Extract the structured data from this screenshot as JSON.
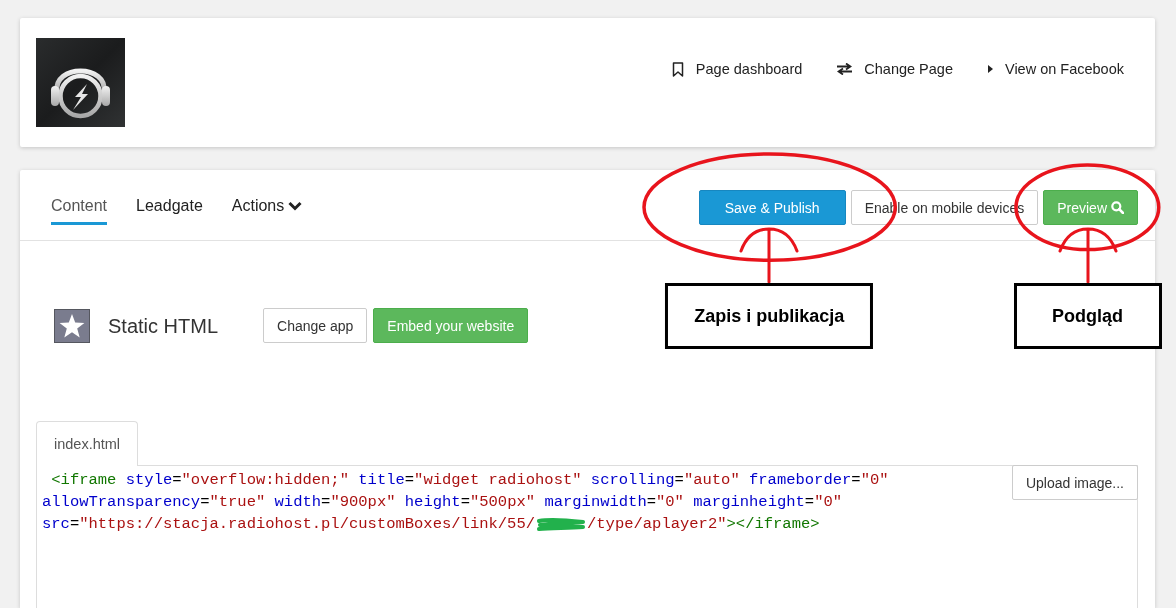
{
  "header": {
    "links": [
      {
        "label": "Page dashboard"
      },
      {
        "label": "Change Page"
      },
      {
        "label": "View on Facebook"
      }
    ]
  },
  "tabs": [
    {
      "label": "Content",
      "selected": true,
      "dropdown": false
    },
    {
      "label": "Leadgate",
      "selected": false,
      "dropdown": false
    },
    {
      "label": "Actions",
      "selected": false,
      "dropdown": true
    }
  ],
  "toolbar": [
    {
      "label": "Save & Publish",
      "kind": "primary",
      "icon": false,
      "annotation": "Zapis i publikacja"
    },
    {
      "label": "Enable on mobile devices",
      "kind": "default",
      "icon": false
    },
    {
      "label": "Preview",
      "kind": "success",
      "icon": true,
      "annotation": "Podgląd"
    }
  ],
  "app": {
    "name": "Static HTML",
    "buttons": [
      {
        "label": "Change app",
        "kind": "default"
      },
      {
        "label": "Embed your website",
        "kind": "success"
      }
    ]
  },
  "editor": {
    "file_tabs": [
      {
        "label": "index.html",
        "selected": true
      }
    ],
    "upload_button": "Upload image...",
    "lines": [
      [
        {
          "kind": "code",
          "tokens": [
            {
              "kind": "tag",
              "text": " <iframe"
            },
            {
              "kind": "attr",
              "text": " style"
            },
            {
              "kind": "plain",
              "text": "="
            },
            {
              "kind": "string",
              "text": "\"overflow:hidden;\""
            },
            {
              "kind": "attr",
              "text": " title"
            },
            {
              "kind": "plain",
              "text": "="
            },
            {
              "kind": "string",
              "text": "\"widget radiohost\""
            },
            {
              "kind": "attr",
              "text": " scrolling"
            },
            {
              "kind": "plain",
              "text": "="
            },
            {
              "kind": "string",
              "text": "\"auto\""
            },
            {
              "kind": "attr",
              "text": " frameborder"
            },
            {
              "kind": "plain",
              "text": "="
            },
            {
              "kind": "string",
              "text": "\"0\""
            }
          ]
        }
      ],
      [
        {
          "kind": "code",
          "tokens": [
            {
              "kind": "attr",
              "text": "allowTransparency"
            },
            {
              "kind": "plain",
              "text": "="
            },
            {
              "kind": "string",
              "text": "\"true\""
            },
            {
              "kind": "attr",
              "text": " width"
            },
            {
              "kind": "plain",
              "text": "="
            },
            {
              "kind": "string",
              "text": "\"900px\""
            },
            {
              "kind": "attr",
              "text": " height"
            },
            {
              "kind": "plain",
              "text": "="
            },
            {
              "kind": "string",
              "text": "\"500px\""
            },
            {
              "kind": "attr",
              "text": " marginwidth"
            },
            {
              "kind": "plain",
              "text": "="
            },
            {
              "kind": "string",
              "text": "\"0\""
            },
            {
              "kind": "attr",
              "text": " marginheight"
            },
            {
              "kind": "plain",
              "text": "="
            },
            {
              "kind": "string",
              "text": "\"0\""
            }
          ]
        }
      ],
      [
        {
          "kind": "code",
          "tokens": [
            {
              "kind": "attr",
              "text": "src"
            },
            {
              "kind": "plain",
              "text": "="
            },
            {
              "kind": "string",
              "text": "\"https://stacja.radiohost.pl/customBoxes/link/55/"
            }
          ]
        },
        {
          "kind": "redaction"
        },
        {
          "kind": "code",
          "tokens": [
            {
              "kind": "string",
              "text": "/type/aplayer2\""
            },
            {
              "kind": "tag",
              "text": "></iframe>"
            }
          ]
        }
      ]
    ]
  }
}
